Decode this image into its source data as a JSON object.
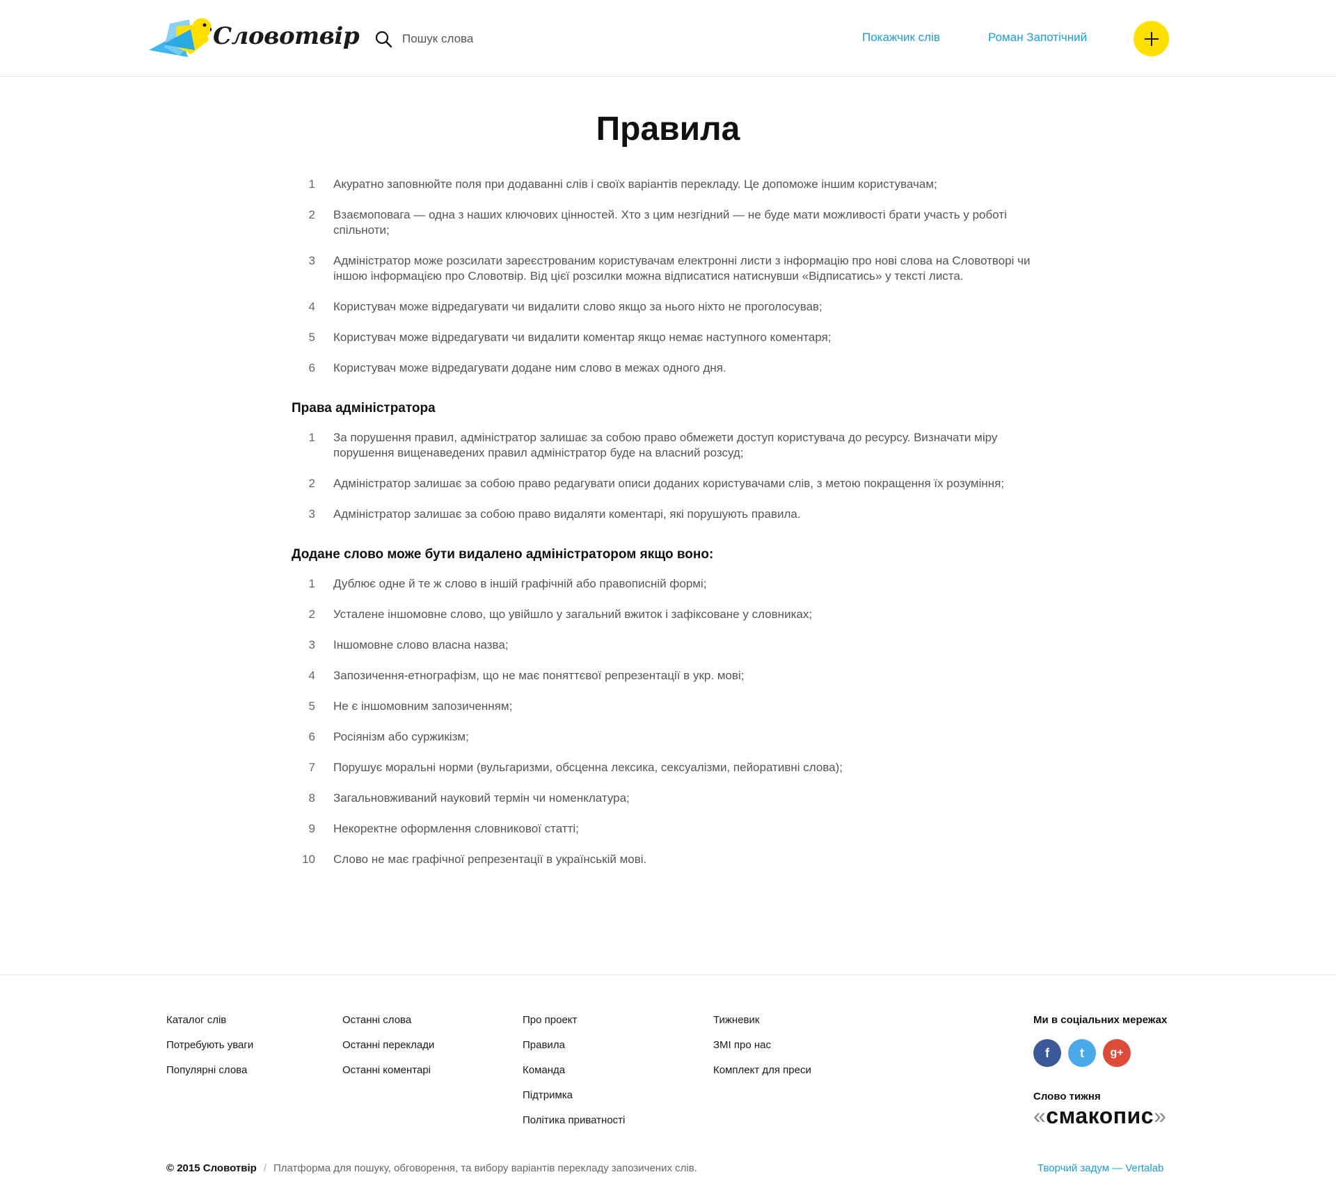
{
  "header": {
    "logo_text": "Словотвір",
    "search_placeholder": "Пошук слова",
    "nav_index": "Покажчик слів",
    "nav_user": "Роман Запотічний",
    "add_icon": "plus-icon"
  },
  "main": {
    "title": "Правила",
    "rules": [
      {
        "num": "1",
        "text": "Акуратно заповнюйте поля при додаванні слів і своїх варіантів перекладу. Це допоможе іншим користувачам;"
      },
      {
        "num": "2",
        "text": "Взаємоповага — одна з наших ключових цінностей. Хто з цим незгідний — не буде мати можливості брати участь у роботі спільноти;"
      },
      {
        "num": "3",
        "text": "Адміністратор може розсилати зареєстрованим користувачам електронні листи з інформацію про нові слова на Словотворі чи іншою інформацією про Словотвір. Від цієї розсилки можна відписатися натиснувши «Відписатись» у тексті листа."
      },
      {
        "num": "4",
        "text": "Користувач може відредагувати чи видалити слово якщо за нього ніхто не проголосував;"
      },
      {
        "num": "5",
        "text": "Користувач може відредагувати чи видалити коментар якщо немає наступного коментаря;"
      },
      {
        "num": "6",
        "text": "Користувач може відредагувати додане ним слово в межах одного дня."
      }
    ],
    "admin_title": "Права адміністратора",
    "admin_rules": [
      {
        "num": "1",
        "text": "За порушення правил, адміністратор залишає за собою право обмежети доступ користувача до ресурсу. Визначати міру порушення вищенаведених правил адміністратор буде на власний розсуд;"
      },
      {
        "num": "2",
        "text": "Адміністратор залишає за собою право редагувати описи доданих користувачами слів, з метою покращення їх розуміння;"
      },
      {
        "num": "3",
        "text": "Адміністратор залишає за собою право видаляти коментарі, які порушують правила."
      }
    ],
    "removal_title": "Додане слово може бути видалено адміністратором якщо воно:",
    "removal_rules": [
      {
        "num": "1",
        "text": "Дублює одне й те ж слово в іншій графічній або правописній формі;"
      },
      {
        "num": "2",
        "text": "Усталене іншомовне слово, що увійшло у загальний вжиток і зафіксоване у словниках;"
      },
      {
        "num": "3",
        "text": "Іншомовне слово власна назва;"
      },
      {
        "num": "4",
        "text": "Запозичення-етнографізм, що не має поняттєвої репрезентації в укр. мові;"
      },
      {
        "num": "5",
        "text": "Не є іншомовним запозиченням;"
      },
      {
        "num": "6",
        "text": "Росіянізм або суржикізм;"
      },
      {
        "num": "7",
        "text": "Порушує моральні норми (вульгаризми, обсценна лексика, сексуалізми, пейоративні слова);"
      },
      {
        "num": "8",
        "text": "Загальновживаний науковий термін чи номенклатура;"
      },
      {
        "num": "9",
        "text": "Некоректне оформлення словникової статті;"
      },
      {
        "num": "10",
        "text": "Слово не має графічної репрезентації в українській мові."
      }
    ]
  },
  "footer": {
    "col1": [
      "Каталог слів",
      "Потребують уваги",
      "Популярні слова"
    ],
    "col2": [
      "Останні слова",
      "Останні переклади",
      "Останні коментарі"
    ],
    "col3": [
      "Про проект",
      "Правила",
      "Команда",
      "Підтримка",
      "Політика приватності"
    ],
    "col4": [
      "Тижневик",
      "ЗМІ про нас",
      "Комплект для преси"
    ],
    "social_title": "Ми в соціальних мережах",
    "social": [
      {
        "name": "facebook-icon",
        "glyph": "f",
        "color": "#3b5998"
      },
      {
        "name": "twitter-icon",
        "glyph": "t",
        "color": "#4aa9e9"
      },
      {
        "name": "google-plus-icon",
        "glyph": "g+",
        "color": "#dd4b39"
      }
    ],
    "word_of_week_label": "Слово тижня",
    "word_of_week": "смакопис",
    "copyright": "© 2015 Словотвір",
    "separator": "/",
    "tagline": "Платформа для пошуку, обговорення, та вибору варіантів перекладу запозичених слів.",
    "credit": "Творчий задум — Vertalab"
  },
  "colors": {
    "accent": "#1a9ee0",
    "add_button": "#ffe000",
    "text": "#555555"
  }
}
